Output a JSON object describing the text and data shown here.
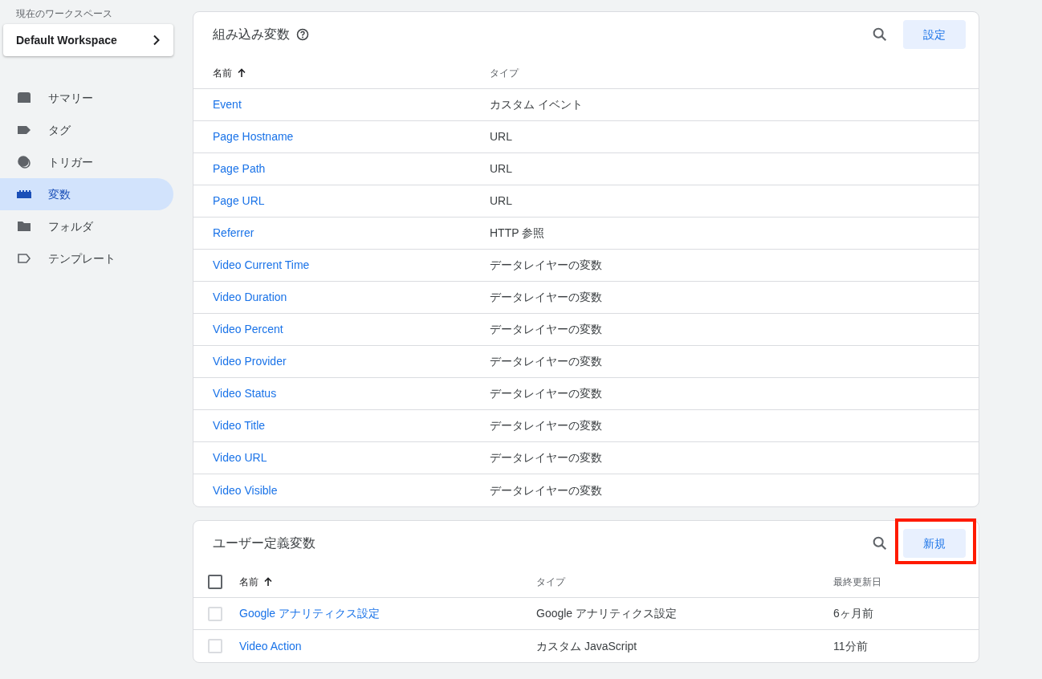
{
  "sidebar": {
    "workspace_label": "現在のワークスペース",
    "workspace_name": "Default Workspace",
    "items": [
      {
        "kind": "summary",
        "label": "サマリー",
        "selected": false
      },
      {
        "kind": "tag",
        "label": "タグ",
        "selected": false
      },
      {
        "kind": "trigger",
        "label": "トリガー",
        "selected": false
      },
      {
        "kind": "variable",
        "label": "変数",
        "selected": true
      },
      {
        "kind": "folder",
        "label": "フォルダ",
        "selected": false
      },
      {
        "kind": "template",
        "label": "テンプレート",
        "selected": false
      }
    ]
  },
  "builtin": {
    "title": "組み込み変数",
    "button": "設定",
    "columns": [
      "名前",
      "タイプ"
    ],
    "rows": [
      {
        "name": "Event",
        "type": "カスタム イベント"
      },
      {
        "name": "Page Hostname",
        "type": "URL"
      },
      {
        "name": "Page Path",
        "type": "URL"
      },
      {
        "name": "Page URL",
        "type": "URL"
      },
      {
        "name": "Referrer",
        "type": "HTTP 参照"
      },
      {
        "name": "Video Current Time",
        "type": "データレイヤーの変数"
      },
      {
        "name": "Video Duration",
        "type": "データレイヤーの変数"
      },
      {
        "name": "Video Percent",
        "type": "データレイヤーの変数"
      },
      {
        "name": "Video Provider",
        "type": "データレイヤーの変数"
      },
      {
        "name": "Video Status",
        "type": "データレイヤーの変数"
      },
      {
        "name": "Video Title",
        "type": "データレイヤーの変数"
      },
      {
        "name": "Video URL",
        "type": "データレイヤーの変数"
      },
      {
        "name": "Video Visible",
        "type": "データレイヤーの変数"
      }
    ]
  },
  "user_defined": {
    "title": "ユーザー定義変数",
    "button": "新規",
    "button_highlighted": true,
    "columns": [
      "名前",
      "タイプ",
      "最終更新日"
    ],
    "select_all_checked": false,
    "rows": [
      {
        "name": "Google アナリティクス設定",
        "type": "Google アナリティクス設定",
        "updated": "6ヶ月前",
        "checked": false
      },
      {
        "name": "Video Action",
        "type": "カスタム JavaScript",
        "updated": "11分前",
        "checked": false
      }
    ]
  }
}
